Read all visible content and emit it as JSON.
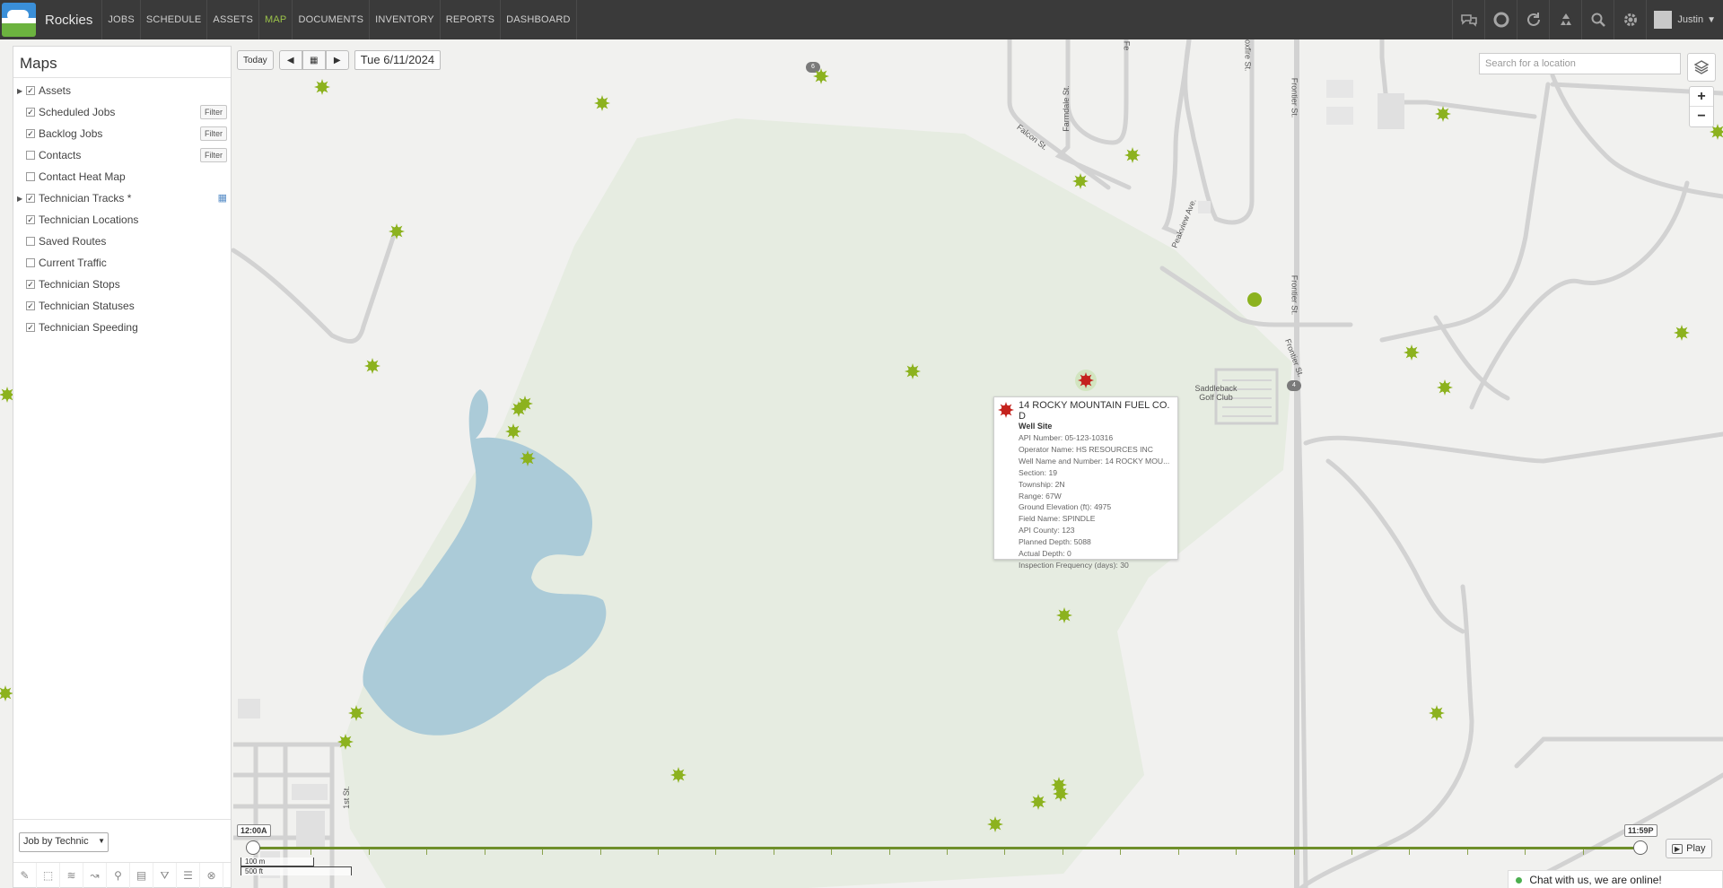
{
  "app": {
    "brand": "Rockies",
    "nav": [
      "JOBS",
      "SCHEDULE",
      "ASSETS",
      "MAP",
      "DOCUMENTS",
      "INVENTORY",
      "REPORTS",
      "DASHBOARD"
    ],
    "active_nav": "MAP",
    "user": "Justin"
  },
  "panel": {
    "title": "Maps",
    "layers": [
      {
        "label": "Assets",
        "checked": true,
        "expandable": true,
        "filter": ""
      },
      {
        "label": "Scheduled Jobs",
        "checked": true,
        "expandable": false,
        "filter": "Filter"
      },
      {
        "label": "Backlog Jobs",
        "checked": true,
        "expandable": false,
        "filter": "Filter"
      },
      {
        "label": "Contacts",
        "checked": false,
        "expandable": false,
        "filter": "Filter"
      },
      {
        "label": "Contact Heat Map",
        "checked": false,
        "expandable": false,
        "filter": ""
      },
      {
        "label": "Technician Tracks *",
        "checked": true,
        "expandable": true,
        "filter": ""
      },
      {
        "label": "Technician Locations",
        "checked": true,
        "expandable": false,
        "filter": ""
      },
      {
        "label": "Saved Routes",
        "checked": false,
        "expandable": false,
        "filter": ""
      },
      {
        "label": "Current Traffic",
        "checked": false,
        "expandable": false,
        "filter": ""
      },
      {
        "label": "Technician Stops",
        "checked": true,
        "expandable": false,
        "filter": ""
      },
      {
        "label": "Technician Statuses",
        "checked": true,
        "expandable": false,
        "filter": ""
      },
      {
        "label": "Technician Speeding",
        "checked": true,
        "expandable": false,
        "filter": ""
      }
    ],
    "group_select": "Job by Technic"
  },
  "datebar": {
    "today": "Today",
    "date": "Tue 6/11/2024"
  },
  "search": {
    "placeholder": "Search for a location"
  },
  "zoom": {
    "in": "+",
    "out": "−"
  },
  "popup": {
    "title": "14 ROCKY MOUNTAIN FUEL CO. D",
    "subtitle": "Well Site",
    "rows": [
      "API Number: 05-123-10316",
      "Operator Name: HS RESOURCES INC",
      "Well Name and Number: 14 ROCKY MOU...",
      "Section: 19",
      "Township: 2N",
      "Range: 67W",
      "Ground Elevation (ft): 4975",
      "Field Name: SPINDLE",
      "API County: 123",
      "Planned Depth: 5088",
      "Actual Depth: 0",
      "Inspection Frequency (days): 30"
    ]
  },
  "timeline": {
    "start": "12:00A",
    "end": "11:59P",
    "play": "Play"
  },
  "scale": {
    "metric": "100 m",
    "imperial": "500 ft"
  },
  "map_labels": {
    "falcon": "Falcon St.",
    "farmdale": "Farmdale St.",
    "peakview": "Peakview Ave.",
    "foxfire": "Foxfire St.",
    "frontier1": "Frontier St.",
    "frontier2": "Frontier St.",
    "frontier3": "Frontier St.",
    "golf": "Saddleback Golf Club",
    "first": "1st St.",
    "fe": "Fe"
  },
  "badges": {
    "b1": "6",
    "b2": "4"
  },
  "chat": {
    "text": "Chat with us, we are online!"
  },
  "colors": {
    "asset_green": "#8cb21e",
    "selected_red": "#c4221d",
    "park": "#e6ece1",
    "water": "#abcbd8",
    "accent": "#9ac14a"
  }
}
